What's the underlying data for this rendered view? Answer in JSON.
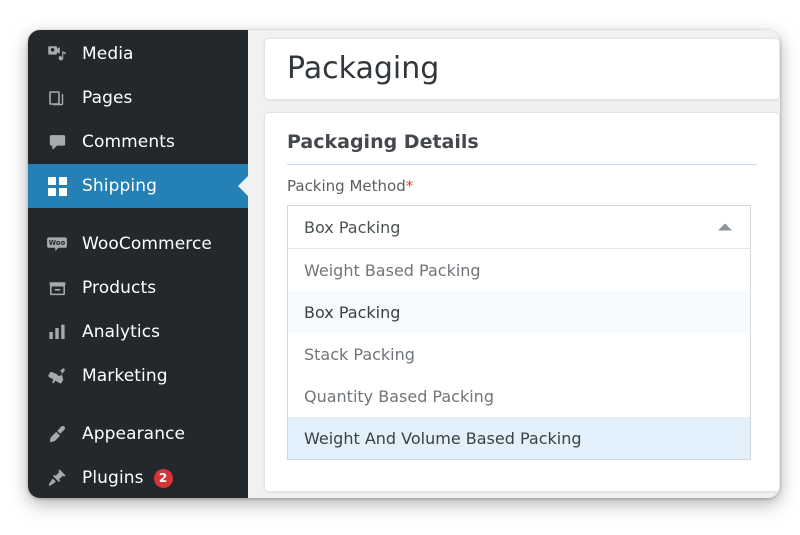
{
  "sidebar": {
    "items": [
      {
        "label": "Media",
        "icon": "media-icon",
        "active": false,
        "badge": null
      },
      {
        "label": "Pages",
        "icon": "pages-icon",
        "active": false,
        "badge": null
      },
      {
        "label": "Comments",
        "icon": "comments-icon",
        "active": false,
        "badge": null
      },
      {
        "label": "Shipping",
        "icon": "grid-icon",
        "active": true,
        "badge": null
      },
      {
        "label": "WooCommerce",
        "icon": "woocommerce-icon",
        "active": false,
        "badge": null
      },
      {
        "label": "Products",
        "icon": "products-icon",
        "active": false,
        "badge": null
      },
      {
        "label": "Analytics",
        "icon": "analytics-icon",
        "active": false,
        "badge": null
      },
      {
        "label": "Marketing",
        "icon": "marketing-icon",
        "active": false,
        "badge": null
      },
      {
        "label": "Appearance",
        "icon": "appearance-icon",
        "active": false,
        "badge": null
      },
      {
        "label": "Plugins",
        "icon": "plugins-icon",
        "active": false,
        "badge": "2"
      }
    ],
    "background_color": "#23282d",
    "active_color": "#2580b5",
    "badge_color": "#d63638"
  },
  "header": {
    "title": "Packaging"
  },
  "packaging_details": {
    "section_heading": "Packaging Details",
    "field_label": "Packing Method",
    "required_marker": "*"
  },
  "packing_method_select": {
    "value": "Box Packing",
    "expanded": true,
    "caret_icon": "chevron-up-icon",
    "options": [
      {
        "label": "Weight Based Packing",
        "state": "normal"
      },
      {
        "label": "Box Packing",
        "state": "selected"
      },
      {
        "label": "Stack Packing",
        "state": "normal"
      },
      {
        "label": "Quantity Based Packing",
        "state": "normal"
      },
      {
        "label": "Weight And Volume Based Packing",
        "state": "highlighted"
      }
    ],
    "selected_row_color": "#f6fafd",
    "highlighted_row_color": "#e2f0fb"
  }
}
